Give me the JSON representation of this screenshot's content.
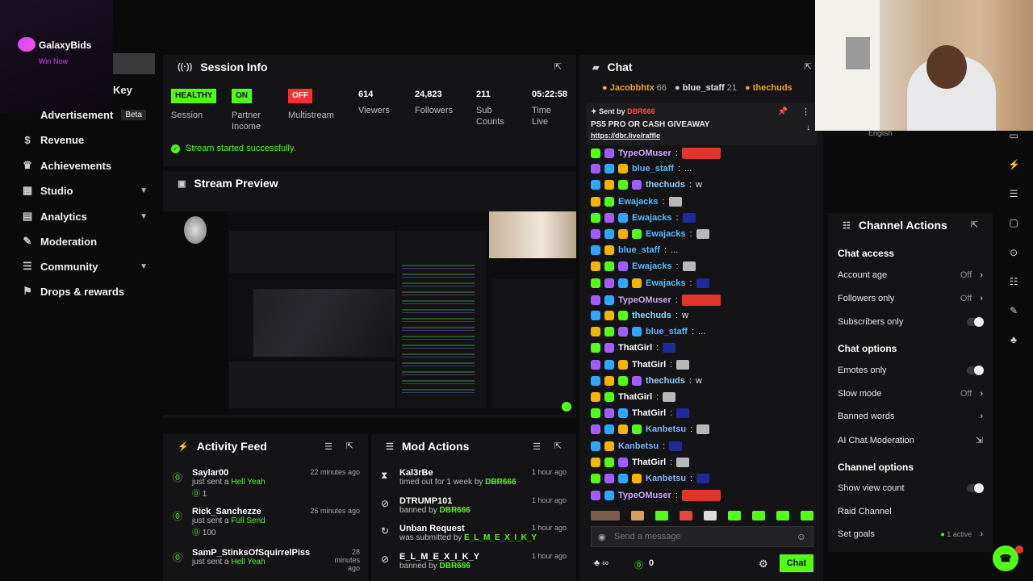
{
  "brand": {
    "name": "GalaxyBids",
    "tagline": "Win Now"
  },
  "sidebar": {
    "key_label": "Key",
    "advertisement": {
      "label": "Advertisement",
      "badge": "Beta"
    },
    "items": [
      {
        "label": "Revenue",
        "icon": "dollar-icon"
      },
      {
        "label": "Achievements",
        "icon": "trophy-icon"
      },
      {
        "label": "Studio",
        "icon": "layout-icon"
      },
      {
        "label": "Analytics",
        "icon": "chart-icon"
      },
      {
        "label": "Moderation",
        "icon": "wrench-icon"
      },
      {
        "label": "Community",
        "icon": "people-icon"
      },
      {
        "label": "Drops & rewards",
        "icon": "gift-icon"
      }
    ]
  },
  "session": {
    "title": "Session Info",
    "stats": [
      {
        "value": "HEALTHY",
        "label": "Session",
        "pill": "green"
      },
      {
        "value": "ON",
        "label": "Partner Income",
        "pill": "green"
      },
      {
        "value": "OFF",
        "label": "Multistream",
        "pill": "red"
      },
      {
        "value": "614",
        "label": "Viewers"
      },
      {
        "value": "24,823",
        "label": "Followers"
      },
      {
        "value": "211",
        "label": "Sub Counts"
      },
      {
        "value": "05:22:58",
        "label": "Time Live"
      }
    ],
    "status": "Stream started successfully."
  },
  "preview": {
    "title": "Stream Preview"
  },
  "activity": {
    "title": "Activity Feed",
    "items": [
      {
        "name": "Saylar00",
        "action": "just sent a",
        "item": "Hell Yeah",
        "amount": "1",
        "time": "22 minutes ago"
      },
      {
        "name": "Rick_Sanchezze",
        "action": "just sent a",
        "item": "Full Send",
        "amount": "100",
        "time": "26 minutes ago"
      },
      {
        "name": "SamP_StinksOfSquirrelPiss",
        "action": "just sent a",
        "item": "Hell Yeah",
        "amount": "",
        "time": "28 minutes ago"
      }
    ]
  },
  "mod": {
    "title": "Mod Actions",
    "items": [
      {
        "name": "Kal3rBe",
        "desc": "timed out for 1 week by",
        "by": "DBR666",
        "time": "1 hour ago",
        "icon": "hourglass-icon"
      },
      {
        "name": "DTRUMP101",
        "desc": "banned by",
        "by": "DBR666",
        "time": "1 hour ago",
        "icon": "ban-icon"
      },
      {
        "name": "Unban Request",
        "desc": "was submitted by",
        "by": "E_L_M_E_X_I_K_Y",
        "time": "1 hour ago",
        "icon": "refresh-icon"
      },
      {
        "name": "E_L_M_E_X_I_K_Y",
        "desc": "banned by",
        "by": "DBR666",
        "time": "1 hour ago",
        "icon": "ban-icon"
      }
    ]
  },
  "chat": {
    "title": "Chat",
    "top_gifters": [
      {
        "name": "Jacobbhtx",
        "count": "66"
      },
      {
        "name": "blue_staff",
        "count": "21"
      },
      {
        "name": "thechuds",
        "count": ""
      }
    ],
    "pinned": {
      "sent_by": "Sent by",
      "sender": "DBR666",
      "text": "PS5 PRO OR CASH GIVEAWAY",
      "link": "https://dbr.live/raffle"
    },
    "messages": [
      {
        "user": "TypeOMuser",
        "text": "",
        "color": "#c9a7ff",
        "emote": "big"
      },
      {
        "user": "blue_staff",
        "text": "...",
        "color": "#5ab9ff",
        "emote": ""
      },
      {
        "user": "thechuds",
        "text": "w",
        "color": "#8fd0ff",
        "emote": ""
      },
      {
        "user": "Ewajacks",
        "text": "",
        "color": "#5ab9ff",
        "emote": "small"
      },
      {
        "user": "Ewajacks",
        "text": "",
        "color": "#5ab9ff",
        "emote": "small"
      },
      {
        "user": "Ewajacks",
        "text": "",
        "color": "#5ab9ff",
        "emote": "small"
      },
      {
        "user": "blue_staff",
        "text": "...",
        "color": "#5ab9ff",
        "emote": ""
      },
      {
        "user": "Ewajacks",
        "text": "",
        "color": "#5ab9ff",
        "emote": "small"
      },
      {
        "user": "Ewajacks",
        "text": "",
        "color": "#5ab9ff",
        "emote": "small"
      },
      {
        "user": "TypeOMuser",
        "text": "",
        "color": "#c9a7ff",
        "emote": "big"
      },
      {
        "user": "thechuds",
        "text": "w",
        "color": "#8fd0ff",
        "emote": ""
      },
      {
        "user": "blue_staff",
        "text": "...",
        "color": "#5ab9ff",
        "emote": ""
      },
      {
        "user": "ThatGirl",
        "text": "",
        "color": "#ffffff",
        "emote": "small"
      },
      {
        "user": "ThatGirl",
        "text": "",
        "color": "#ffffff",
        "emote": "small"
      },
      {
        "user": "thechuds",
        "text": "w",
        "color": "#8fd0ff",
        "emote": ""
      },
      {
        "user": "ThatGirl",
        "text": "",
        "color": "#ffffff",
        "emote": "small"
      },
      {
        "user": "ThatGirl",
        "text": "",
        "color": "#ffffff",
        "emote": "small"
      },
      {
        "user": "Kanbetsu",
        "text": "",
        "color": "#7fb2ff",
        "emote": "small"
      },
      {
        "user": "Kanbetsu",
        "text": "",
        "color": "#7fb2ff",
        "emote": "small"
      },
      {
        "user": "ThatGirl",
        "text": "",
        "color": "#ffffff",
        "emote": "small"
      },
      {
        "user": "Kanbetsu",
        "text": "",
        "color": "#7fb2ff",
        "emote": "small"
      },
      {
        "user": "TypeOMuser",
        "text": "",
        "color": "#c9a7ff",
        "emote": "big"
      }
    ],
    "input_placeholder": "Send a message",
    "count": "0",
    "send_label": "Chat"
  },
  "webcam": {
    "label": "English"
  },
  "channel_actions": {
    "title": "Channel Actions",
    "access_title": "Chat access",
    "account_age": {
      "label": "Account age",
      "value": "Off"
    },
    "followers_only": {
      "label": "Followers only",
      "value": "Off"
    },
    "subscribers_only": {
      "label": "Subscribers only"
    },
    "options_title": "Chat options",
    "emotes_only": {
      "label": "Emotes only"
    },
    "slow_mode": {
      "label": "Slow mode",
      "value": "Off"
    },
    "banned_words": {
      "label": "Banned words"
    },
    "ai_moderation": {
      "label": "AI Chat Moderation"
    },
    "channel_title": "Channel options",
    "show_viewer": {
      "label": "Show view count"
    },
    "raid": {
      "label": "Raid Channel"
    },
    "goals": {
      "label": "Set goals",
      "value": "1 active"
    }
  },
  "colors": {
    "accent": "#53fc18",
    "bg": "#0b0b0c",
    "panel": "#141416",
    "danger": "#ff4d4d"
  }
}
